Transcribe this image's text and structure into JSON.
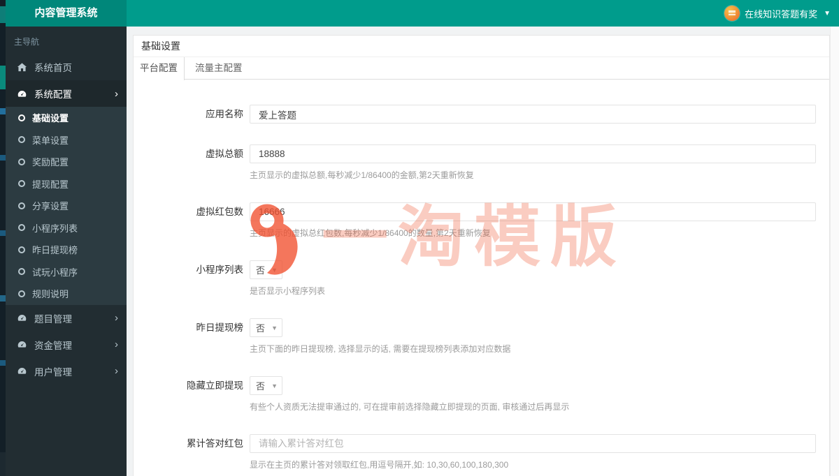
{
  "app": {
    "title": "内容管理系统"
  },
  "header": {
    "user_menu_label": "在线知识答题有奖"
  },
  "sidebar": {
    "section_label": "主导航",
    "items": [
      {
        "label": "系统首页",
        "icon": "home-icon"
      },
      {
        "label": "系统配置",
        "icon": "gauge-icon",
        "expanded": true,
        "active": true,
        "children": [
          {
            "label": "基础设置",
            "active": true
          },
          {
            "label": "菜单设置"
          },
          {
            "label": "奖励配置"
          },
          {
            "label": "提现配置"
          },
          {
            "label": "分享设置"
          },
          {
            "label": "小程序列表"
          },
          {
            "label": "昨日提现榜"
          },
          {
            "label": "试玩小程序"
          },
          {
            "label": "规则说明"
          }
        ]
      },
      {
        "label": "题目管理",
        "icon": "gauge-icon"
      },
      {
        "label": "资金管理",
        "icon": "gauge-icon"
      },
      {
        "label": "用户管理",
        "icon": "gauge-icon"
      }
    ]
  },
  "main": {
    "panel_title": "基础设置",
    "tabs": [
      {
        "label": "平台配置",
        "active": true
      },
      {
        "label": "流量主配置",
        "active": false
      }
    ],
    "form": {
      "fields": [
        {
          "label": "应用名称",
          "type": "text",
          "value": "爱上答题"
        },
        {
          "label": "虚拟总额",
          "type": "text",
          "value": "18888",
          "help": "主页显示的虚拟总额,每秒减少1/86400的金额,第2天重新恢复"
        },
        {
          "label": "虚拟红包数",
          "type": "text",
          "value": "16666",
          "help": "主页显示的虚拟总红包数,每秒减少1/86400的数量,第2天重新恢复"
        },
        {
          "label": "小程序列表",
          "type": "select",
          "value": "否",
          "help": "是否显示小程序列表"
        },
        {
          "label": "昨日提现榜",
          "type": "select",
          "value": "否",
          "help": "主页下面的昨日提现榜, 选择显示的话, 需要在提现榜列表添加对应数据"
        },
        {
          "label": "隐藏立即提现",
          "type": "select",
          "value": "否",
          "help": "有些个人资质无法提审通过的, 可在提审前选择隐藏立即提现的页面, 审核通过后再显示"
        },
        {
          "label": "累计答对红包",
          "type": "text",
          "value": "",
          "placeholder": "请输入累计答对红包",
          "help": "显示在主页的累计答对领取红包,用逗号隔开,如: 10,30,60,100,180,300"
        }
      ]
    },
    "watermark": {
      "text": "一淘模版"
    }
  },
  "colors": {
    "header_bg": "#009c8c",
    "logo_bg": "#00877a",
    "sidebar_bg": "#222d32",
    "submenu_bg": "#2c3b41",
    "watermark": "#ef5a35"
  }
}
